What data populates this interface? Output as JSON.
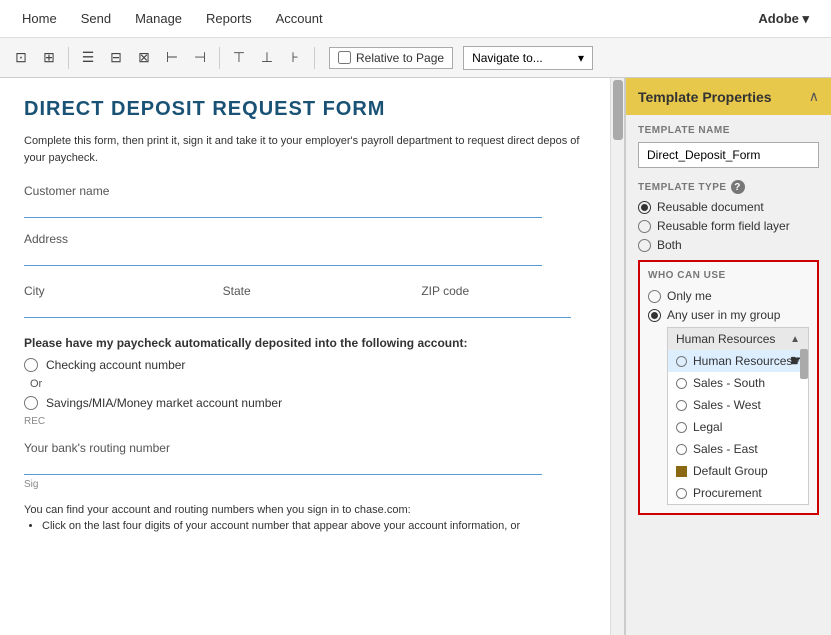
{
  "menubar": {
    "items": [
      "Home",
      "Send",
      "Manage",
      "Reports",
      "Account"
    ],
    "adobe_label": "Adobe ▾"
  },
  "toolbar": {
    "icons": [
      "⊞",
      "⊟",
      "⊠",
      "⊡",
      "⊢",
      "⊣",
      "⊤",
      "⊥",
      "⊦"
    ],
    "relative_to_page_label": "Relative to Page",
    "navigate_label": "Navigate to...",
    "navigate_arrow": "▾"
  },
  "document": {
    "title": "DIRECT DEPOSIT REQUEST FORM",
    "intro": "Complete this form, then print it, sign it and take it to your employer's payroll department to request direct depos\nof your paycheck.",
    "fields": {
      "customer_name": "Customer name",
      "address": "Address",
      "city": "City",
      "state": "State",
      "zip": "ZIP code",
      "section_label": "Please have my paycheck automatically deposited into the following account:",
      "checking": "Checking account number",
      "or": "Or",
      "savings": "Savings/MIA/Money market account number",
      "rec_label": "REC",
      "routing": "Your bank's routing number",
      "sig_label": "Sig",
      "find_info": "You can find your account and routing numbers when you sign in to chase.com:",
      "bullet1": "Click on the last four digits of your account number that appear above your account information, or"
    }
  },
  "right_panel": {
    "header": "Template Properties",
    "collapse_icon": "∧",
    "template_name_label": "TEMPLATE NAME",
    "template_name_value": "Direct_Deposit_Form",
    "template_type_label": "TEMPLATE TYPE",
    "help_icon": "?",
    "types": [
      {
        "label": "Reusable document",
        "selected": true
      },
      {
        "label": "Reusable form field layer",
        "selected": false
      },
      {
        "label": "Both",
        "selected": false
      }
    ],
    "who_can_use_label": "WHO CAN USE",
    "who_can_use_options": [
      {
        "label": "Only me",
        "selected": false
      },
      {
        "label": "Any user in my group",
        "selected": true
      }
    ],
    "group_dropdown_header": "Human Resources",
    "scroll_arrow": "▲",
    "group_list": [
      {
        "label": "Human Resources",
        "type": "radio",
        "highlighted": true
      },
      {
        "label": "Sales - South",
        "type": "radio",
        "highlighted": false
      },
      {
        "label": "Sales - West",
        "type": "radio",
        "highlighted": false
      },
      {
        "label": "Legal",
        "type": "radio",
        "highlighted": false
      },
      {
        "label": "Sales - East",
        "type": "radio",
        "highlighted": false
      },
      {
        "label": "Default Group",
        "type": "square",
        "highlighted": false
      },
      {
        "label": "Procurement",
        "type": "radio",
        "highlighted": false
      }
    ]
  }
}
